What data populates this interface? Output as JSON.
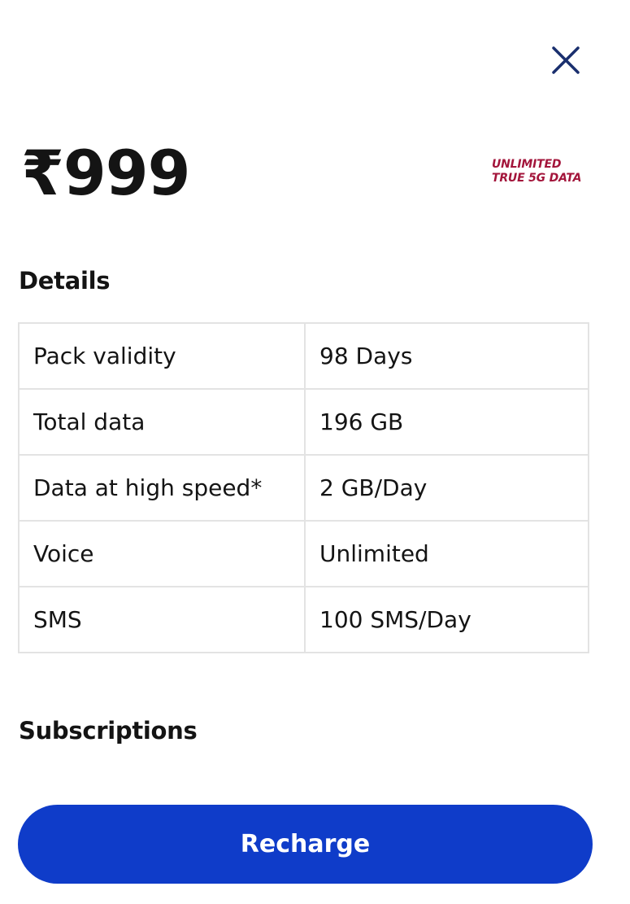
{
  "header": {
    "close_icon": "close-icon",
    "close_color": "#1a2f6e"
  },
  "plan": {
    "price": "₹999",
    "badge_line1": "UNLIMITED",
    "badge_line2": "TRUE 5G DATA",
    "badge_color": "#a3153b"
  },
  "details": {
    "title": "Details",
    "rows": [
      {
        "label": "Pack validity",
        "value": "98 Days"
      },
      {
        "label": "Total data",
        "value": "196 GB"
      },
      {
        "label": "Data at high speed*",
        "value": "2 GB/Day"
      },
      {
        "label": "Voice",
        "value": "Unlimited"
      },
      {
        "label": "SMS",
        "value": "100 SMS/Day"
      }
    ]
  },
  "subscriptions": {
    "title": "Subscriptions"
  },
  "actions": {
    "recharge_label": "Recharge",
    "recharge_color": "#0f3cc9"
  }
}
